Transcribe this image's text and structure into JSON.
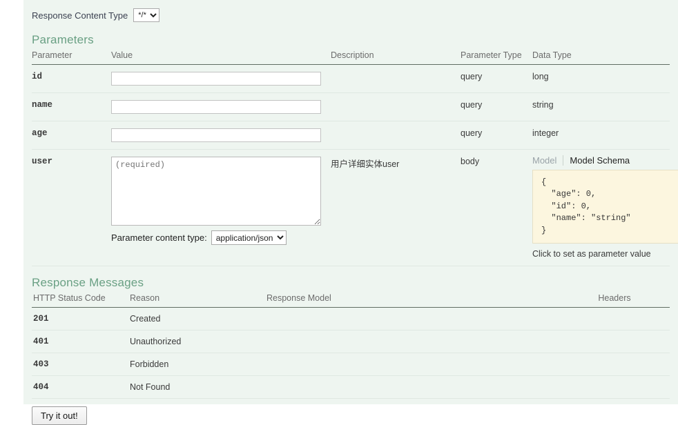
{
  "response_content_type": {
    "label": "Response Content Type",
    "selected": "*/*",
    "options": [
      "*/*"
    ]
  },
  "parameters": {
    "title": "Parameters",
    "headers": {
      "parameter": "Parameter",
      "value": "Value",
      "description": "Description",
      "parameter_type": "Parameter Type",
      "data_type": "Data Type"
    },
    "rows": [
      {
        "name": "id",
        "value": "",
        "placeholder": "",
        "description": "",
        "parameter_type": "query",
        "data_type": "long"
      },
      {
        "name": "name",
        "value": "",
        "placeholder": "",
        "description": "",
        "parameter_type": "query",
        "data_type": "string"
      },
      {
        "name": "age",
        "value": "",
        "placeholder": "",
        "description": "",
        "parameter_type": "query",
        "data_type": "integer"
      },
      {
        "name": "user",
        "value": "",
        "placeholder": "(required)",
        "description": "用户详细实体user",
        "parameter_type": "body",
        "data_type": ""
      }
    ],
    "content_type": {
      "label": "Parameter content type:",
      "selected": "application/json",
      "options": [
        "application/json"
      ]
    },
    "model": {
      "tab_model": "Model",
      "tab_model_schema": "Model Schema",
      "active_tab": "Model Schema",
      "schema": "{\n  \"age\": 0,\n  \"id\": 0,\n  \"name\": \"string\"\n}",
      "hint": "Click to set as parameter value"
    }
  },
  "response_messages": {
    "title": "Response Messages",
    "headers": {
      "status_code": "HTTP Status Code",
      "reason": "Reason",
      "response_model": "Response Model",
      "headers": "Headers"
    },
    "rows": [
      {
        "code": "201",
        "reason": "Created",
        "model": "",
        "headers": ""
      },
      {
        "code": "401",
        "reason": "Unauthorized",
        "model": "",
        "headers": ""
      },
      {
        "code": "403",
        "reason": "Forbidden",
        "model": "",
        "headers": ""
      },
      {
        "code": "404",
        "reason": "Not Found",
        "model": "",
        "headers": ""
      }
    ]
  },
  "try_button": {
    "label": "Try it out!"
  },
  "colors": {
    "background": "#eef5f0",
    "section_heading": "#6aa084",
    "header_rule": "#5f6c62",
    "row_rule": "#dfe8e2",
    "schema_bg": "#fcf6df",
    "schema_border": "#e6dfc4"
  }
}
